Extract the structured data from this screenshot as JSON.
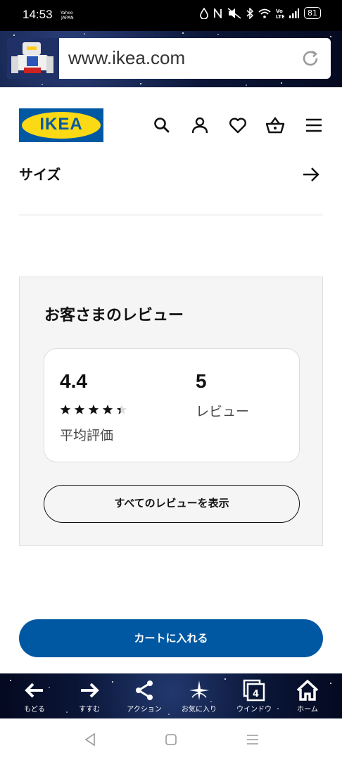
{
  "status_bar": {
    "time": "14:53",
    "app_glyph": "Yahoo JAPAN",
    "battery": "81",
    "icons": [
      "droplet-icon",
      "nfc-icon",
      "mute-icon",
      "bluetooth-icon",
      "wifi-icon",
      "volte-icon",
      "signal-icon",
      "battery-icon"
    ]
  },
  "browser": {
    "url": "www.ikea.com"
  },
  "header": {
    "logo_text": "IKEA",
    "icons": [
      "search-icon",
      "account-icon",
      "heart-icon",
      "basket-icon",
      "menu-icon"
    ]
  },
  "size_row": {
    "label": "サイズ"
  },
  "reviews": {
    "title": "お客さまのレビュー",
    "average_value": "4.4",
    "average_label": "平均評価",
    "rating": 4.4,
    "max_rating": 5,
    "count_value": "5",
    "count_label": "レビュー",
    "show_all_label": "すべてのレビューを表示"
  },
  "cart": {
    "label": "カートに入れる"
  },
  "toolbar": {
    "items": [
      {
        "label": "もどる",
        "icon": "back-arrow-icon"
      },
      {
        "label": "すすむ",
        "icon": "forward-arrow-icon"
      },
      {
        "label": "アクション",
        "icon": "share-icon"
      },
      {
        "label": "お気に入り",
        "icon": "favorites-icon"
      },
      {
        "label": "ウインドウ",
        "icon": "windows-icon",
        "count": "4"
      },
      {
        "label": "ホーム",
        "icon": "home-icon"
      }
    ]
  },
  "colors": {
    "ikea_blue": "#0058a3",
    "ikea_yellow": "#fbd914",
    "panel_bg": "#f5f5f5"
  }
}
